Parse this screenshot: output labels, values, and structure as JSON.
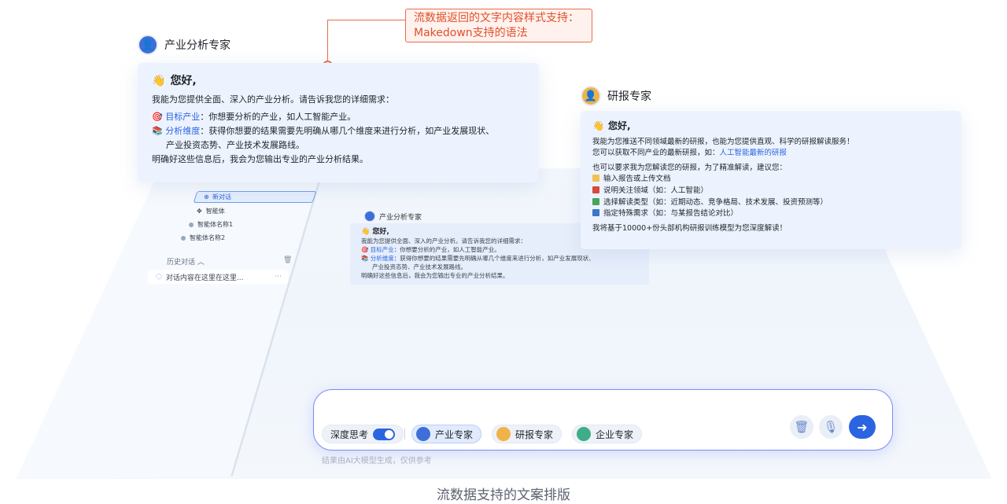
{
  "annotation": {
    "line1": "流数据返回的文字内容样式支持：",
    "line2": "Makedown支持的语法"
  },
  "agent1": {
    "name": "产业分析专家",
    "greeting": "您好,",
    "intro": "我能为您提供全面、深入的产业分析。请告诉我您的详细需求：",
    "item1_label": "目标产业",
    "item1_text": "：你想要分析的产业，如人工智能产业。",
    "item2_label": "分析维度",
    "item2_text": "：获得你想要的结果需要先明确从哪几个维度来进行分析，如产业发展现状、",
    "item2_cont": "产业投资态势、产业技术发展路线。",
    "outro": "明确好这些信息后，我会为您输出专业的产业分析结果。"
  },
  "agent2": {
    "name": "研报专家",
    "greeting": "您好,",
    "line1": "我能为您推送不同领域最新的研报，也能为您提供直观、科学的研报解读服务！",
    "line2_pre": "您可以获取不同产业的最新研报，如：",
    "line2_link": "人工智能最新的研报",
    "line3": "也可以要求我为您解读您的研报，为了精准解读，建议您：",
    "steps": [
      "输入报告或上传文档",
      "说明关注领域（如：人工智能）",
      "选择解读类型（如：近期动态、竞争格局、技术发展、投资预测等）",
      "指定特殊需求（如：与某报告结论对比）"
    ],
    "outro": "我将基于10000+份头部机构研报训练模型为您深度解读！"
  },
  "sidebar": {
    "new_chat": "新对话",
    "agent": "智能体",
    "agent1": "智能体名称1",
    "agent2": "智能体名称2",
    "history": "历史对话",
    "conversation": "对话内容在这里在这里..."
  },
  "mini": {
    "name": "产业分析专家",
    "greeting": "您好,",
    "intro": "我能为您提供全面、深入的产业分析。请告诉我您的详细需求：",
    "item1_label": "目标产业",
    "item1_text": "：你想要分析的产业，如人工智能产业。",
    "item2_label": "分析维度",
    "item2_text": "：获得你想要的结果需要先明确从哪几个维度来进行分析，如产业发展现状、",
    "item2_cont": "产业投资态势、产业技术发展路线。",
    "outro": "明确好这些信息后，我会为您输出专业的产业分析结果。"
  },
  "input": {
    "deep_think": "深度思考",
    "chip1": "产业专家",
    "chip2": "研报专家",
    "chip3": "企业专家",
    "disclaimer": "结果由AI大模型生成，仅供参考"
  },
  "caption": "流数据支持的文案排版",
  "colors": {
    "accent": "#2a64e0",
    "annotation": "#e86c4a",
    "card_bg": "#edf3fe"
  }
}
